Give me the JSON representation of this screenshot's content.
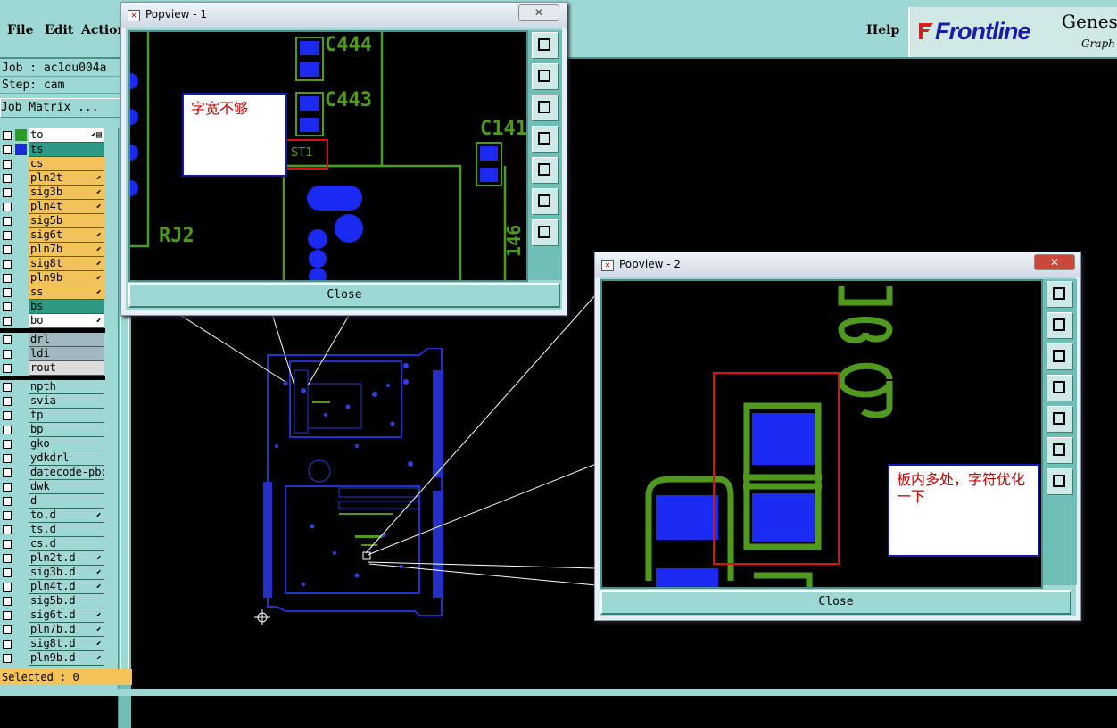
{
  "menubar": {
    "file": "File",
    "edit": "Edit",
    "actions": "Actions",
    "help": "Help",
    "logo_brand": "Frontline",
    "logo_product": "Genes",
    "logo_sub": "Graph"
  },
  "left": {
    "job": "Job : ac1du004a",
    "step": "Step: cam",
    "job_matrix": "Job Matrix ...",
    "selected": "Selected : 0"
  },
  "layers": [
    {
      "name": "to",
      "color": "#ffffff",
      "swatch": "#2b9a2b",
      "flag": "⬋▤"
    },
    {
      "name": "ts",
      "color": "#2c9a86",
      "swatch": "#1a2ad8",
      "flag": ""
    },
    {
      "name": "cs",
      "color": "#f3c35a",
      "swatch": "",
      "flag": ""
    },
    {
      "name": "pln2t",
      "color": "#f3c35a",
      "swatch": "",
      "flag": "⬋"
    },
    {
      "name": "sig3b",
      "color": "#f3c35a",
      "swatch": "",
      "flag": "⬋"
    },
    {
      "name": "pln4t",
      "color": "#f3c35a",
      "swatch": "",
      "flag": "⬋"
    },
    {
      "name": "sig5b",
      "color": "#f3c35a",
      "swatch": "",
      "flag": ""
    },
    {
      "name": "sig6t",
      "color": "#f3c35a",
      "swatch": "",
      "flag": "⬋"
    },
    {
      "name": "pln7b",
      "color": "#f3c35a",
      "swatch": "",
      "flag": "⬋"
    },
    {
      "name": "sig8t",
      "color": "#f3c35a",
      "swatch": "",
      "flag": "⬋"
    },
    {
      "name": "pln9b",
      "color": "#f3c35a",
      "swatch": "",
      "flag": "⬋"
    },
    {
      "name": "ss",
      "color": "#f3c35a",
      "swatch": "",
      "flag": "⬋"
    },
    {
      "name": "bs",
      "color": "#2c9a86",
      "swatch": "",
      "flag": ""
    },
    {
      "name": "bo",
      "color": "#ffffff",
      "swatch": "",
      "flag": "⬋"
    },
    {
      "name": "drl",
      "color": "#9fb8c0",
      "swatch": "",
      "flag": ""
    },
    {
      "name": "ldi",
      "color": "#9fb8c0",
      "swatch": "",
      "flag": ""
    },
    {
      "name": "rout",
      "color": "#dcdcdc",
      "swatch": "",
      "flag": ""
    },
    {
      "name": "npth",
      "color": "#9ed8d4",
      "swatch": "",
      "flag": ""
    },
    {
      "name": "svia",
      "color": "#9ed8d4",
      "swatch": "",
      "flag": ""
    },
    {
      "name": "tp",
      "color": "#9ed8d4",
      "swatch": "",
      "flag": ""
    },
    {
      "name": "bp",
      "color": "#9ed8d4",
      "swatch": "",
      "flag": ""
    },
    {
      "name": "gko",
      "color": "#9ed8d4",
      "swatch": "",
      "flag": ""
    },
    {
      "name": "ydkdrl",
      "color": "#9ed8d4",
      "swatch": "",
      "flag": ""
    },
    {
      "name": "datecode-pbc",
      "color": "#9ed8d4",
      "swatch": "",
      "flag": ""
    },
    {
      "name": "dwk",
      "color": "#9ed8d4",
      "swatch": "",
      "flag": ""
    },
    {
      "name": "d",
      "color": "#9ed8d4",
      "swatch": "",
      "flag": ""
    },
    {
      "name": "to.d",
      "color": "#9ed8d4",
      "swatch": "",
      "flag": "⬋"
    },
    {
      "name": "ts.d",
      "color": "#9ed8d4",
      "swatch": "",
      "flag": ""
    },
    {
      "name": "cs.d",
      "color": "#9ed8d4",
      "swatch": "",
      "flag": ""
    },
    {
      "name": "pln2t.d",
      "color": "#9ed8d4",
      "swatch": "",
      "flag": "⬋"
    },
    {
      "name": "sig3b.d",
      "color": "#9ed8d4",
      "swatch": "",
      "flag": "⬋"
    },
    {
      "name": "pln4t.d",
      "color": "#9ed8d4",
      "swatch": "",
      "flag": "⬋"
    },
    {
      "name": "sig5b.d",
      "color": "#9ed8d4",
      "swatch": "",
      "flag": ""
    },
    {
      "name": "sig6t.d",
      "color": "#9ed8d4",
      "swatch": "",
      "flag": "⬋"
    },
    {
      "name": "pln7b.d",
      "color": "#9ed8d4",
      "swatch": "",
      "flag": "⬋"
    },
    {
      "name": "sig8t.d",
      "color": "#9ed8d4",
      "swatch": "",
      "flag": "⬋"
    },
    {
      "name": "pln9b.d",
      "color": "#9ed8d4",
      "swatch": "",
      "flag": "⬋"
    }
  ],
  "popup1": {
    "title": "Popview - 1",
    "close_x": "✕",
    "close_label": "Close",
    "note": "字宽不够",
    "labels": {
      "c444": "C444",
      "c443": "C443",
      "c141": "C141",
      "rj2": "RJ2",
      "st1": "ST1",
      "v146": "146"
    }
  },
  "popup2": {
    "title": "Popview - 2",
    "close_x": "✕",
    "close_label": "Close",
    "note": "板内多处，字符优化一下",
    "labels": {
      "c39": "C39"
    }
  },
  "colors": {
    "panel": "#9ed8d4",
    "trace": "#4f9a1e",
    "pad": "#1a2af0",
    "board": "#2430c8",
    "note_text": "#c00000"
  }
}
